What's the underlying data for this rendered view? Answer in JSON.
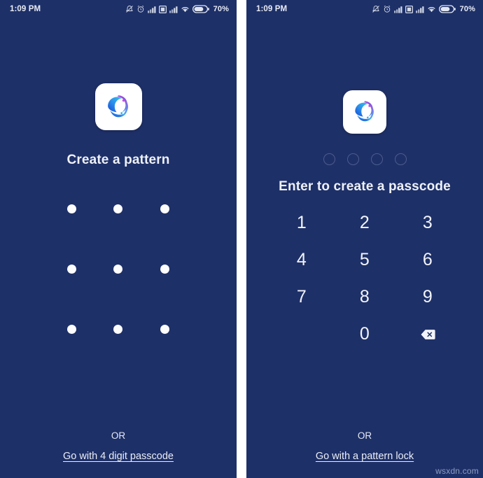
{
  "colors": {
    "background": "#1e3068",
    "text": "#eef1f8",
    "dot": "#fdfdfe",
    "dot_outline": "#4d5c90",
    "logo_white": "#ffffff",
    "logo_purple": "#a24bd8",
    "logo_blue": "#1760e8",
    "logo_cyan": "#22b6ef",
    "watermark": "#8e9ec4"
  },
  "statusbar": {
    "time": "1:09 PM",
    "battery_percent": "70%",
    "icons": [
      "mute-icon",
      "alarm-icon",
      "signal-sim1-icon",
      "sim-card-icon",
      "signal-sim2-icon",
      "wifi-icon",
      "battery-icon"
    ]
  },
  "screens": [
    {
      "id": "pattern-screen",
      "logo_name": "app-logo",
      "heading": "Create a pattern",
      "pattern_dots": [
        [
          "dot-1",
          "dot-2",
          "dot-3"
        ],
        [
          "dot-4",
          "dot-5",
          "dot-6"
        ],
        [
          "dot-7",
          "dot-8",
          "dot-9"
        ]
      ],
      "or_text": "OR",
      "alt_link": "Go with 4 digit passcode"
    },
    {
      "id": "passcode-screen",
      "logo_name": "app-logo",
      "passcode_dots": [
        "pin-dot-1",
        "pin-dot-2",
        "pin-dot-3",
        "pin-dot-4"
      ],
      "passcode_entered": "",
      "heading": "Enter to create a passcode",
      "keypad": [
        "1",
        "2",
        "3",
        "4",
        "5",
        "6",
        "7",
        "8",
        "9",
        "",
        "0",
        "backspace-icon"
      ],
      "or_text": "OR",
      "alt_link": "Go with a pattern lock"
    }
  ],
  "watermark": "wsxdn.com"
}
